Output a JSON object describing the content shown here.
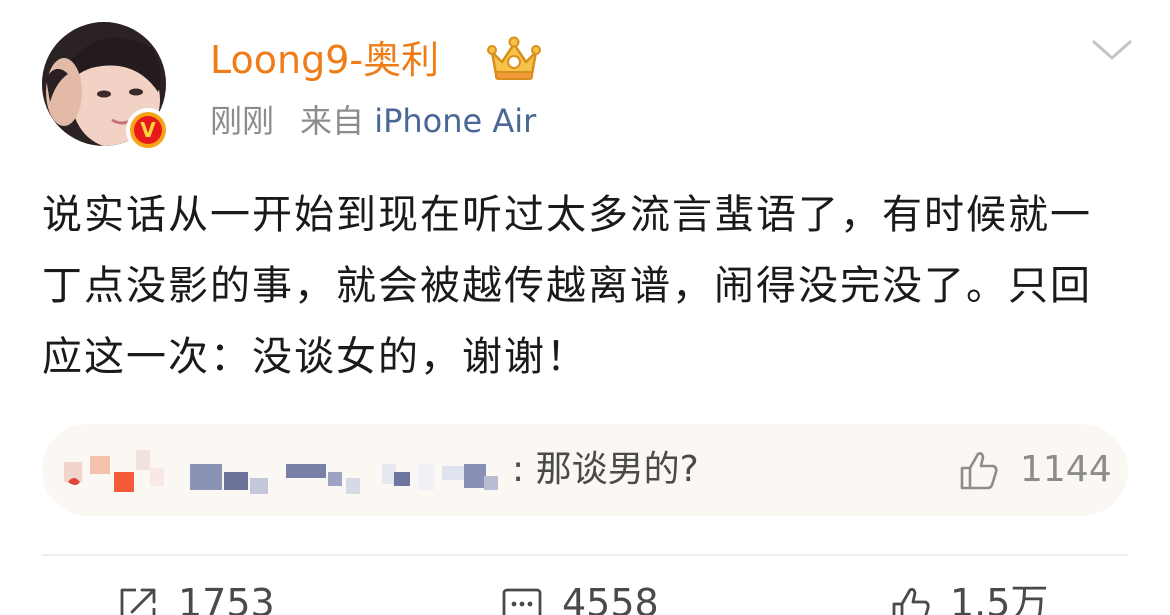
{
  "user": {
    "name": "Loong9-奥利",
    "verified_badge_glyph": "V",
    "avatar": "profile-photo"
  },
  "meta": {
    "time": "刚刚",
    "from_prefix": "来自",
    "device": "iPhone Air"
  },
  "post": {
    "text": "说实话从一开始到现在听过太多流言蜚语了，有时候就一丁点没影的事，就会被越传越离谱，闹得没完没了。只回应这一次：没谈女的，谢谢！"
  },
  "hot_comment": {
    "username": "",
    "text": ": 那谈男的?",
    "likes": "1144"
  },
  "actions": {
    "repost_count": "1753",
    "comment_count": "4558",
    "like_count": "1.5万"
  },
  "colors": {
    "username": "#f07c18",
    "device_link": "#4a6796",
    "meta_gray": "#8c8c8c",
    "comment_bg": "#fbf7f3"
  },
  "icons": [
    "crown-icon",
    "chevron-down-icon",
    "thumbs-up-icon",
    "repost-icon",
    "comment-icon",
    "verified-icon"
  ]
}
